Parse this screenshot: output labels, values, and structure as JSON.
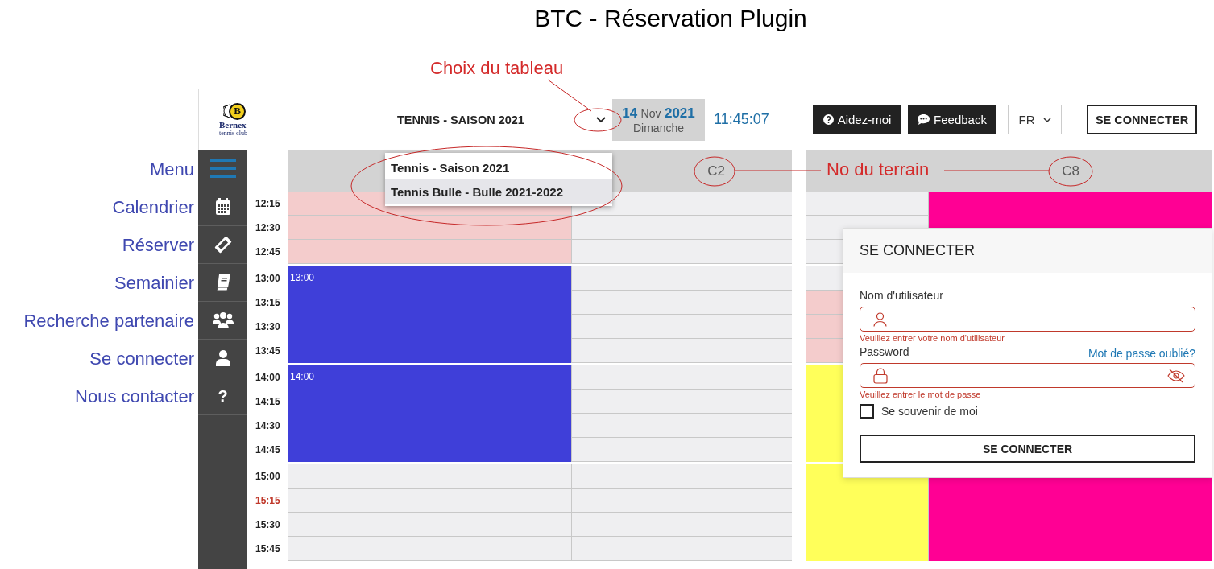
{
  "title": "BTC - Réservation Plugin",
  "annotations": {
    "side_labels": [
      "Menu",
      "Calendrier",
      "Réserver",
      "Semainier",
      "Recherche partenaire",
      "Se connecter",
      "Nous contacter"
    ],
    "callouts": [
      {
        "kind": "board",
        "text": "Choix du tableau"
      },
      {
        "kind": "court",
        "text": "No du terrain"
      }
    ]
  },
  "header": {
    "logo": {
      "letter": "B",
      "name": "Bernex",
      "tagline": "tennis club"
    },
    "board": "TENNIS - SAISON 2021",
    "date": {
      "day": "14",
      "month": "Nov",
      "year": "2021",
      "weekday": "Dimanche"
    },
    "clock": "11:45:07",
    "buttons": [
      {
        "kind": "help",
        "label": "Aidez-moi"
      },
      {
        "kind": "feedback",
        "label": "Feedback"
      }
    ],
    "language": "FR",
    "login_button": "SE CONNECTER"
  },
  "sidebar": {
    "items": [
      {
        "kind": "menu"
      },
      {
        "kind": "calendar"
      },
      {
        "kind": "ticket"
      },
      {
        "kind": "book"
      },
      {
        "kind": "users"
      },
      {
        "kind": "user"
      },
      {
        "kind": "help",
        "glyph": "?"
      }
    ]
  },
  "board_menu": {
    "items": [
      {
        "label": "Tennis - Saison 2021",
        "selected": false
      },
      {
        "label": "Tennis Bulle - Bulle 2021-2022",
        "selected": true
      }
    ]
  },
  "grid": {
    "sections": [
      {
        "court": "C2"
      },
      {
        "court": "C8"
      }
    ],
    "groups": [
      {
        "times": [
          {
            "label": "12:15",
            "current": false
          },
          {
            "label": "12:30",
            "current": false
          },
          {
            "label": "12:45",
            "current": false
          }
        ],
        "columns": [
          {
            "kind": "slots",
            "slots": [
              {
                "color": "#f4cccc"
              },
              {
                "color": "#f4cccc"
              },
              {
                "color": "#f4cccc"
              }
            ]
          },
          {
            "kind": "slots",
            "slots": [
              {
                "color": "#efeff1"
              },
              {
                "color": "#efeff1"
              },
              {
                "color": "#efeff1"
              }
            ]
          },
          {
            "kind": "slots",
            "slots": [
              {
                "color": "#efeff1"
              },
              {
                "color": "#efeff1"
              },
              {
                "color": "#efeff1"
              }
            ]
          },
          {
            "kind": "booking",
            "color": "#ff0094"
          }
        ]
      },
      {
        "times": [
          {
            "label": "13:00",
            "current": false
          },
          {
            "label": "13:15",
            "current": false
          },
          {
            "label": "13:30",
            "current": false
          },
          {
            "label": "13:45",
            "current": false
          }
        ],
        "columns": [
          {
            "kind": "booking",
            "color": "#3f3fd9",
            "label": "13:00"
          },
          {
            "kind": "slots",
            "slots": [
              {
                "color": "#efeff1"
              },
              {
                "color": "#efeff1"
              },
              {
                "color": "#efeff1"
              },
              {
                "color": "#efeff1"
              }
            ]
          },
          {
            "kind": "slots",
            "slots": [
              {
                "color": "#efeff1"
              },
              {
                "color": "#f4cccc"
              },
              {
                "color": "#f4cccc"
              },
              {
                "color": "#f4cccc"
              }
            ]
          },
          null
        ]
      },
      {
        "times": [
          {
            "label": "14:00",
            "current": false
          },
          {
            "label": "14:15",
            "current": false
          },
          {
            "label": "14:30",
            "current": false
          },
          {
            "label": "14:45",
            "current": false
          }
        ],
        "columns": [
          {
            "kind": "booking",
            "color": "#3f3fd9",
            "label": "14:00"
          },
          {
            "kind": "slots",
            "slots": [
              {
                "color": "#efeff1"
              },
              {
                "color": "#efeff1"
              },
              {
                "color": "#efeff1"
              },
              {
                "color": "#efeff1"
              }
            ]
          },
          {
            "kind": "booking",
            "color": "#ffff5a"
          },
          null
        ]
      },
      {
        "times": [
          {
            "label": "15:00",
            "current": false
          },
          {
            "label": "15:15",
            "current": true
          },
          {
            "label": "15:30",
            "current": false
          },
          {
            "label": "15:45",
            "current": false
          }
        ],
        "columns": [
          {
            "kind": "slots",
            "slots": [
              {
                "color": "#efeff1"
              },
              {
                "color": "#efeff1"
              },
              {
                "color": "#efeff1"
              },
              {
                "color": "#efeff1"
              }
            ]
          },
          {
            "kind": "slots",
            "slots": [
              {
                "color": "#efeff1"
              },
              {
                "color": "#efeff1"
              },
              {
                "color": "#efeff1"
              },
              {
                "color": "#efeff1"
              }
            ]
          },
          {
            "kind": "booking",
            "color": "#ffff5a"
          },
          {
            "kind": "booking",
            "color": "#ff0094"
          }
        ]
      }
    ]
  },
  "login": {
    "title": "SE CONNECTER",
    "username": {
      "label": "Nom d'utilisateur",
      "error": "Veuillez entrer votre nom d'utilisateur"
    },
    "password": {
      "label": "Password",
      "forgot": "Mot de passe oublié?",
      "error": "Veuillez entrer le mot de passe"
    },
    "remember": {
      "label": "Se souvenir de moi",
      "checked": false
    },
    "submit": "SE CONNECTER"
  }
}
